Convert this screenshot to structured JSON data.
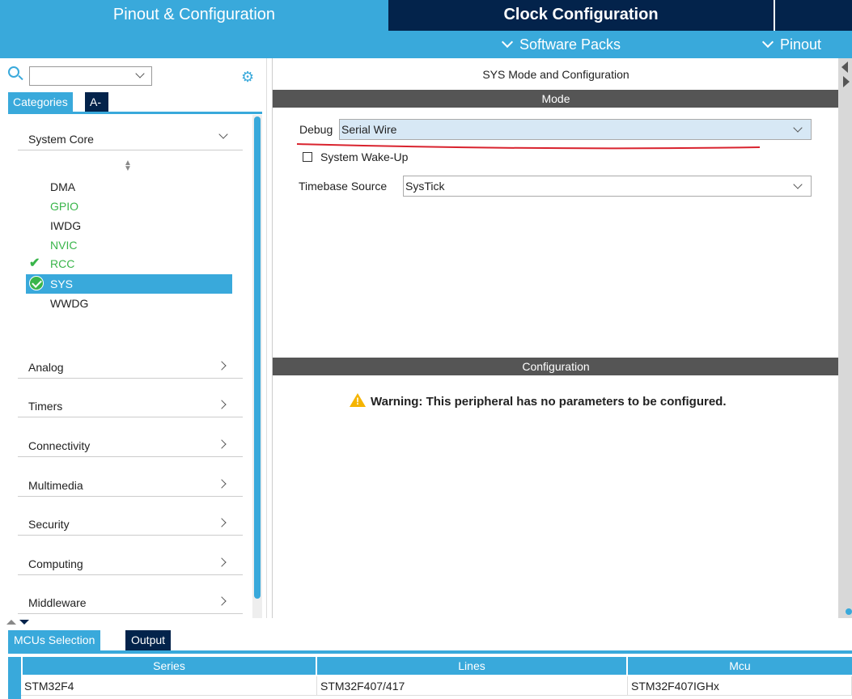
{
  "top_tabs": {
    "pinout": "Pinout & Configuration",
    "clock": "Clock Configuration"
  },
  "sub_bar": {
    "software_packs": "Software Packs",
    "pinout": "Pinout"
  },
  "sidebar": {
    "search": {
      "value": ""
    },
    "tabs": [
      "Categories",
      "A->Z"
    ],
    "active_tab": "Categories",
    "expanded_category": {
      "label": "System Core",
      "peripherals": [
        {
          "name": "DMA",
          "status": "plain"
        },
        {
          "name": "GPIO",
          "status": "green"
        },
        {
          "name": "IWDG",
          "status": "plain"
        },
        {
          "name": "NVIC",
          "status": "green"
        },
        {
          "name": "RCC",
          "status": "checked"
        },
        {
          "name": "SYS",
          "status": "selected"
        },
        {
          "name": "WWDG",
          "status": "plain"
        }
      ]
    },
    "categories": [
      "Analog",
      "Timers",
      "Connectivity",
      "Multimedia",
      "Security",
      "Computing",
      "Middleware"
    ]
  },
  "main": {
    "title": "SYS Mode and Configuration",
    "mode_section": "Mode",
    "debug_label": "Debug",
    "debug_value": "Serial Wire",
    "wakeup_label": "System Wake-Up",
    "wakeup_checked": false,
    "timebase_label": "Timebase Source",
    "timebase_value": "SysTick",
    "config_section": "Configuration",
    "warning": "Warning: This peripheral has no parameters to be configured."
  },
  "bottom": {
    "tabs": [
      "MCUs Selection",
      "Output"
    ],
    "active_tab": "MCUs Selection",
    "columns": [
      "Series",
      "Lines",
      "Mcu"
    ],
    "rows": [
      [
        "STM32F4",
        "STM32F407/417",
        "STM32F407IGHx"
      ]
    ]
  },
  "colors": {
    "accent": "#39a9db",
    "navy": "#03234b",
    "section_bar": "#555555",
    "green": "#39b54a",
    "annotation_red": "#d9232e",
    "warning": "#f5b400"
  }
}
